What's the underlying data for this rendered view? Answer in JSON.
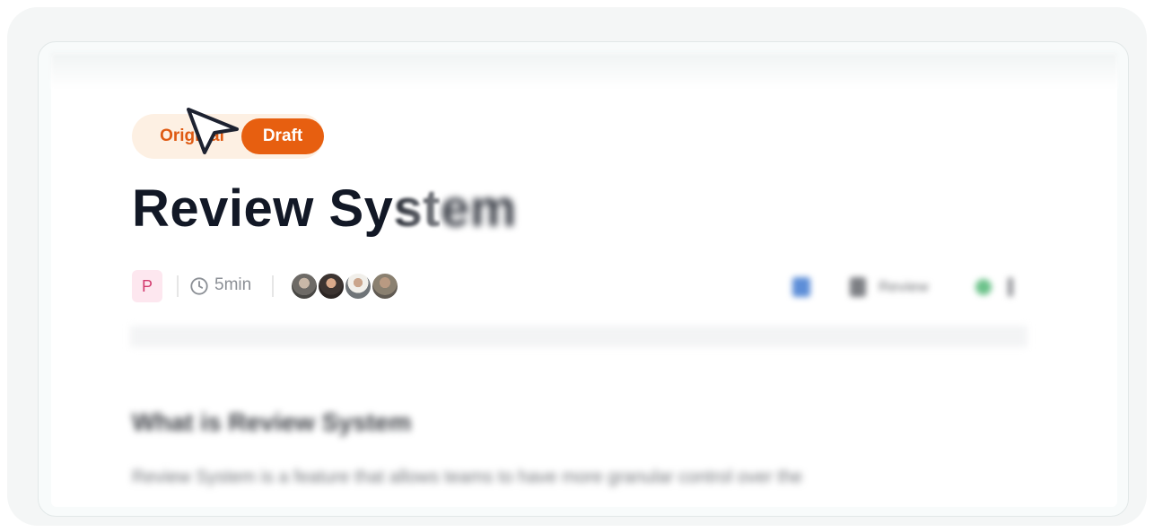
{
  "toggle": {
    "original_label": "Original",
    "draft_label": "Draft",
    "selected": "Draft"
  },
  "document": {
    "title_clear": "Review Sy",
    "title_fade": "st",
    "title_blur": "em",
    "badge_letter": "P",
    "read_time": "5min",
    "collaborator_count": 4,
    "actions": {
      "review_label": "Review"
    },
    "section_heading": "What is Review System",
    "section_body": "Review System is a feature that allows teams to have more granular control over the"
  },
  "colors": {
    "accent": "#e75f10",
    "accent_soft": "#fdf0e3",
    "title": "#121826",
    "badge_bg": "#fde7ef",
    "badge_fg": "#d23b6e"
  },
  "icons": [
    "clock-icon",
    "cursor-arrow-icon",
    "bookmark-icon",
    "document-icon",
    "status-dot-icon",
    "more-vertical-icon"
  ]
}
